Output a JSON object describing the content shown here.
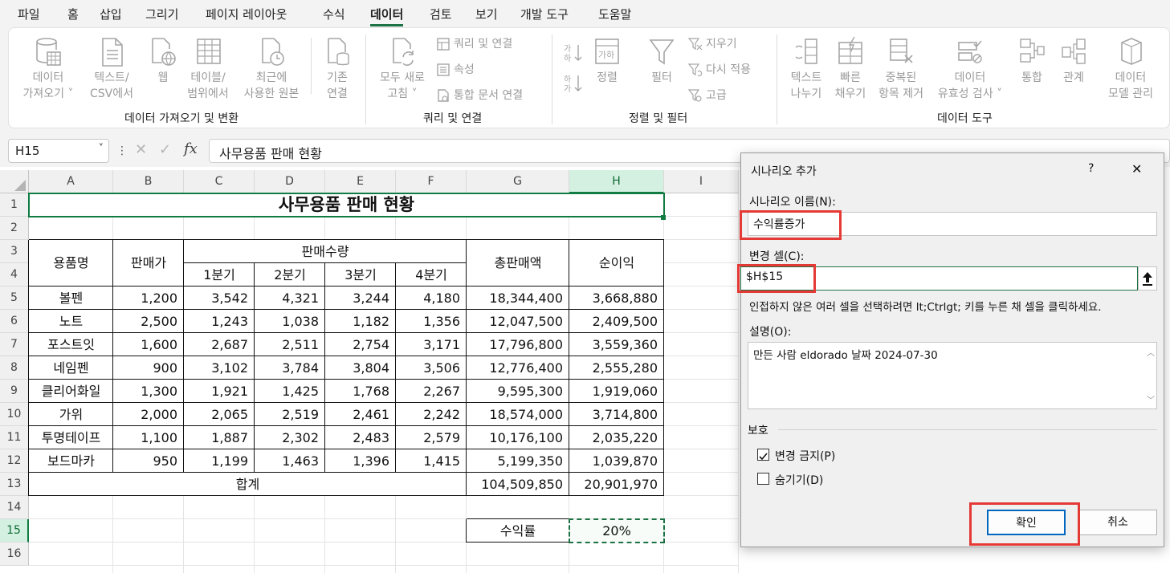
{
  "menu": [
    "파일",
    "홈",
    "삽입",
    "그리기",
    "페이지 레이아웃",
    "수식",
    "데이터",
    "검토",
    "보기",
    "개발 도구",
    "도움말"
  ],
  "ribbon": {
    "get_data": {
      "l1": "데이터",
      "l2": "가져오기"
    },
    "text_csv": {
      "l1": "텍스트/",
      "l2": "CSV에서"
    },
    "web": "웹",
    "table_range": {
      "l1": "테이블/",
      "l2": "범위에서"
    },
    "recent": {
      "l1": "최근에",
      "l2": "사용한 원본"
    },
    "existing": {
      "l1": "기존",
      "l2": "연결"
    },
    "group1": "데이터 가져오기 및 변환",
    "refresh_all": {
      "l1": "모두 새로",
      "l2": "고침"
    },
    "queries": "쿼리 및 연결",
    "properties": "속성",
    "edit_links": "통합 문서 연결",
    "group2": "쿼리 및 연결",
    "sort": "정렬",
    "filter": "필터",
    "clear": "지우기",
    "reapply": "다시 적용",
    "advanced": "고급",
    "group3": "정렬 및 필터",
    "text_to_cols": {
      "l1": "텍스트",
      "l2": "나누기"
    },
    "flash_fill": {
      "l1": "빠른",
      "l2": "채우기"
    },
    "remove_dup": {
      "l1": "중복된",
      "l2": "항목 제거"
    },
    "validation": {
      "l1": "데이터",
      "l2": "유효성 검사"
    },
    "consolidate": "통합",
    "relations": "관계",
    "data_model": {
      "l1": "데이터",
      "l2": "모델 관리"
    },
    "group4": "데이터 도구"
  },
  "formula_bar": {
    "name_box": "H15",
    "fx_label": "fx",
    "content": "사무용품 판매 현황"
  },
  "columns": [
    "A",
    "B",
    "C",
    "D",
    "E",
    "F",
    "G",
    "H",
    "I"
  ],
  "rows": [
    "1",
    "2",
    "3",
    "4",
    "5",
    "6",
    "7",
    "8",
    "9",
    "10",
    "11",
    "12",
    "13",
    "14",
    "15",
    "16"
  ],
  "sheet": {
    "title": "사무용품 판매 현황",
    "headers": {
      "item": "용품명",
      "price": "판매가",
      "qty": "판매수량",
      "q1": "1분기",
      "q2": "2분기",
      "q3": "3분기",
      "q4": "4분기",
      "total": "총판매액",
      "profit": "순이익"
    },
    "data": [
      [
        "볼펜",
        "1,200",
        "3,542",
        "4,321",
        "3,244",
        "4,180",
        "18,344,400",
        "3,668,880"
      ],
      [
        "노트",
        "2,500",
        "1,243",
        "1,038",
        "1,182",
        "1,356",
        "12,047,500",
        "2,409,500"
      ],
      [
        "포스트잇",
        "1,600",
        "2,687",
        "2,511",
        "2,754",
        "3,171",
        "17,796,800",
        "3,559,360"
      ],
      [
        "네임펜",
        "900",
        "3,102",
        "3,784",
        "3,804",
        "3,506",
        "12,776,400",
        "2,555,280"
      ],
      [
        "클리어화일",
        "1,300",
        "1,921",
        "1,425",
        "1,768",
        "2,267",
        "9,595,300",
        "1,919,060"
      ],
      [
        "가위",
        "2,000",
        "2,065",
        "2,519",
        "2,461",
        "2,242",
        "18,574,000",
        "3,714,800"
      ],
      [
        "투명테이프",
        "1,100",
        "1,887",
        "2,302",
        "2,483",
        "2,579",
        "10,176,100",
        "2,035,220"
      ],
      [
        "보드마카",
        "950",
        "1,199",
        "1,463",
        "1,396",
        "1,415",
        "5,199,350",
        "1,039,870"
      ]
    ],
    "sum_label": "합계",
    "sum_total": "104,509,850",
    "sum_profit": "20,901,970",
    "rate_label": "수익률",
    "rate_value": "20%"
  },
  "dialog": {
    "title": "시나리오 추가",
    "help": "?",
    "close": "✕",
    "name_label": "시나리오 이름(N):",
    "name_value": "수익률증가",
    "cells_label": "변경 셀(C):",
    "cells_value": "$H$15",
    "hint": "인접하지 않은 여러 셀을 선택하려면 lt;Ctrlgt; 키를 누른 채 셀을 클릭하세요.",
    "desc_label": "설명(O):",
    "desc_value": "만든 사람 eldorado 날짜 2024-07-30",
    "protect_label": "보호",
    "prevent_changes": "변경 금지(P)",
    "prevent_checked": true,
    "hide": "숨기기(D)",
    "hide_checked": false,
    "ok": "확인",
    "cancel": "취소"
  },
  "colors": {
    "accent": "#107c41",
    "highlight": "#e53935",
    "selection": "#1e7145"
  }
}
